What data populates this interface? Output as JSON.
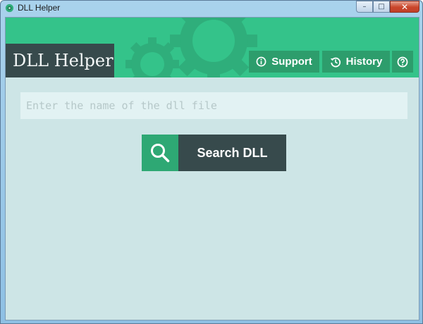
{
  "window": {
    "title": "DLL Helper",
    "controls": {
      "minimize": "–",
      "maximize": "□",
      "close": "✕"
    }
  },
  "header": {
    "app_title": "DLL Helper",
    "buttons": [
      {
        "label": "Support",
        "icon": "info-circle-icon"
      },
      {
        "label": "History",
        "icon": "history-icon"
      },
      {
        "label": "",
        "icon": "question-circle-icon"
      }
    ]
  },
  "search": {
    "placeholder": "Enter the name of the dll file",
    "value": "",
    "button_label": "Search DLL",
    "button_icon": "search-icon"
  },
  "colors": {
    "header_green": "#34c38a",
    "button_green": "#2d9d6c",
    "dark_slate": "#374a4c",
    "body_bg": "#cde5e6",
    "input_bg": "#e2f2f3"
  }
}
